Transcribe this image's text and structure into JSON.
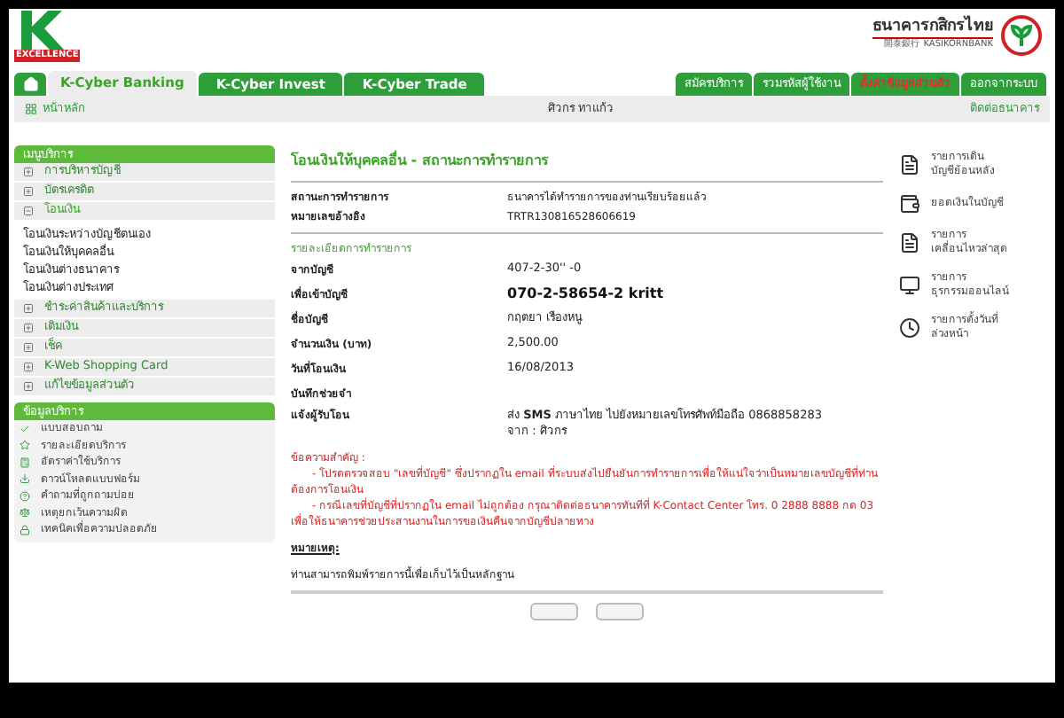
{
  "header": {
    "logo_label": "EXCELLENCE",
    "bank_name_th": "ธนาคารกสิกรไทย",
    "bank_name_cn": "開泰銀行",
    "bank_name_en": "KASIKORNBANK"
  },
  "tabs": [
    {
      "label": "K-Cyber Banking",
      "selected": true
    },
    {
      "label": "K-Cyber Invest",
      "selected": false
    },
    {
      "label": "K-Cyber Trade",
      "selected": false
    }
  ],
  "top_links": [
    {
      "label": "สมัครบริการ",
      "highlighted": false
    },
    {
      "label": "รวมรหัสผู้ใช้งาน",
      "highlighted": false
    },
    {
      "label": "ตั้งค่าข้อมูลส่วนตัว",
      "highlighted": true
    },
    {
      "label": "ออกจากระบบ",
      "highlighted": false
    }
  ],
  "subbar": {
    "home": "หน้าหลัก",
    "user": "ศิวกร ทาแก้ว",
    "contact": "ติดต่อธนาคาร"
  },
  "sidebar": {
    "title": "เมนูบริการ",
    "items": [
      {
        "label": "การบริหารบัญชี",
        "expanded": false
      },
      {
        "label": "บัตรเครดิต",
        "expanded": false
      },
      {
        "label": "โอนเงิน",
        "expanded": true,
        "children": [
          {
            "label": "โอนเงินระหว่างบัญชีตนเอง"
          },
          {
            "label": "โอนเงินให้บุคคลอื่น"
          },
          {
            "label": "โอนเงินต่างธนาคาร"
          },
          {
            "label": "โอนเงินต่างประเทศ"
          }
        ]
      },
      {
        "label": "ชำระค่าสินค้าและบริการ",
        "expanded": false
      },
      {
        "label": "เติมเงิน",
        "expanded": false
      },
      {
        "label": "เช็ค",
        "expanded": false
      },
      {
        "label": "K-Web Shopping Card",
        "expanded": false
      },
      {
        "label": "แก้ไขข้อมูลส่วนตัว",
        "expanded": false
      }
    ]
  },
  "info_menu": {
    "title": "ข้อมูลบริการ",
    "items": [
      {
        "label": "แบบสอบถาม"
      },
      {
        "label": "รายละเอียดบริการ"
      },
      {
        "label": "อัตราค่าใช้บริการ"
      },
      {
        "label": "ดาวน์โหลดแบบฟอร์ม"
      },
      {
        "label": "คำถามที่ถูกถามบ่อย"
      },
      {
        "label": "เหตุยกเว้นความผิด"
      },
      {
        "label": "เทคนิคเพื่อความปลอดภัย"
      }
    ]
  },
  "page": {
    "title": "โอนเงินให้บุคคลอื่น - สถานะการทำรายการ",
    "status_rows": [
      {
        "label": "สถานะการทำรายการ",
        "value": "ธนาคารได้ทำรายการของท่านเรียบร้อยแล้ว"
      },
      {
        "label": "หมายเลขอ้างอิง",
        "value": "TRTR130816528606619"
      }
    ],
    "details_title": "รายละเอียดการทำรายการ",
    "detail_rows": [
      {
        "label": "จากบัญชี",
        "value": "407-2-30'' -0"
      },
      {
        "label": "เพื่อเข้าบัญชี",
        "value": "070-2-58654-2 kritt",
        "emphasis": true
      },
      {
        "label": "ชื่อบัญชี",
        "value": "กฤตยา เรืองหนู"
      },
      {
        "label": "จำนวนเงิน (บาท)",
        "value": "2,500.00"
      },
      {
        "label": "วันที่โอนเงิน",
        "value": "16/08/2013"
      },
      {
        "label": "บันทึกช่วยจำ"
      }
    ],
    "notify": {
      "label": "แจ้งผู้รับโอน",
      "lines": [
        "ส่ง **SMS** ภาษาไทย ไปยังหมายเลขโทรศัพท์มือถือ 0868858283",
        "จาก : ศิวกร"
      ]
    },
    "important": {
      "title": "ข้อความสำคัญ :",
      "items": [
        "- โปรดตรวจสอบ \"เลขที่บัญชี\" ซึ่งปรากฏใน email ที่ระบบส่งไปยืนยันการทำรายการเพื่อให้แน่ใจว่าเป็นหมายเลขบัญชีที่ท่านต้องการโอนเงิน",
        "- กรณีเลขที่บัญชีที่ปรากฏใน email ไม่ถูกต้อง กรุณาติดต่อธนาคารทันทีที่ K-Contact Center โทร. 0 2888 8888 กด 03 เพื่อให้ธนาคารช่วยประสานงานในการขอเงินคืนจากบัญชีปลายทาง"
      ]
    },
    "note": {
      "title": "หมายเหตุ:",
      "text": "ท่านสามารถพิมพ์รายการนี้เพื่อเก็บไว้เป็นหลักฐาน"
    }
  },
  "right_links": [
    {
      "lines": [
        "รายการเดิน",
        "บัญชีย้อนหลัง"
      ]
    },
    {
      "lines": [
        "ยอดเงินในบัญชี"
      ]
    },
    {
      "lines": [
        "รายการ",
        "เคลื่อนไหวล่าสุด"
      ]
    },
    {
      "lines": [
        "รายการ",
        "ธุรกรรมออนไลน์"
      ]
    },
    {
      "lines": [
        "รายการตั้งวันที่",
        "ล่วงหน้า"
      ]
    }
  ]
}
